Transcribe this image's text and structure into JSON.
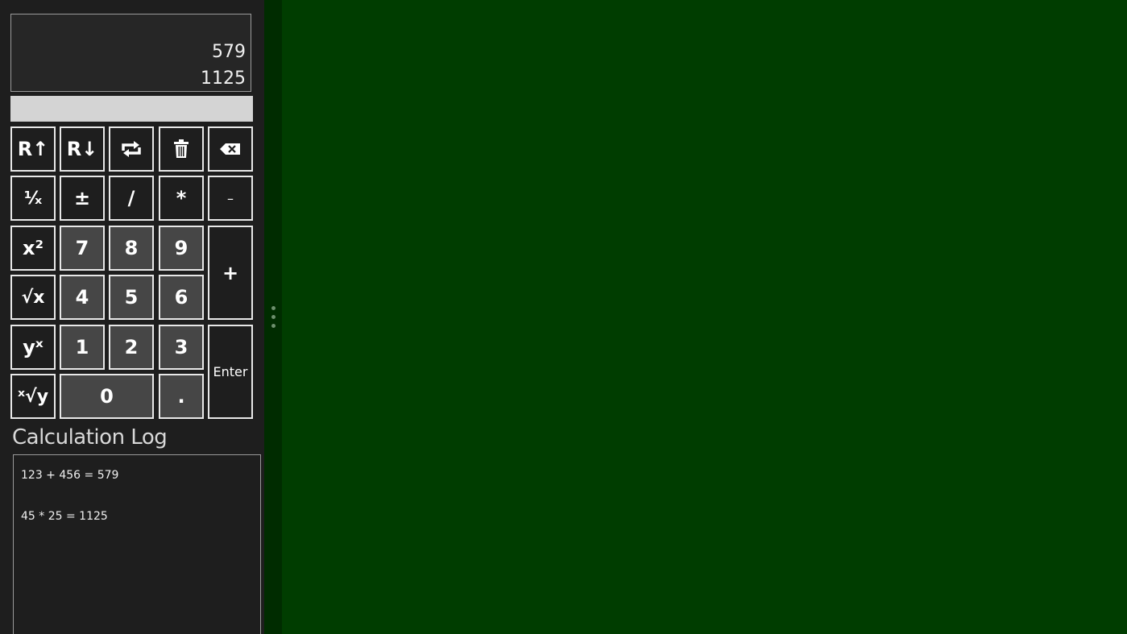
{
  "display": {
    "stack": [
      "579",
      "1125"
    ],
    "entry_value": ""
  },
  "keys": {
    "roll_up": "R↑",
    "roll_down": "R↓",
    "swap_icon": "swap-icon",
    "clear_icon": "trash-icon",
    "backspace_icon": "backspace-icon",
    "reciprocal": "¹⁄ₓ",
    "negate": "±",
    "divide": "/",
    "multiply": "*",
    "subtract": "–",
    "square": "x²",
    "sqrt": "√x",
    "power": "yˣ",
    "root": "ˣ√y",
    "add": "+",
    "enter": "Enter",
    "seven": "7",
    "eight": "8",
    "nine": "9",
    "four": "4",
    "five": "5",
    "six": "6",
    "one": "1",
    "two": "2",
    "three": "3",
    "zero": "0",
    "decimal": "."
  },
  "log": {
    "title": "Calculation Log",
    "entries": [
      "123 + 456 = 579",
      "45 * 25 = 1125"
    ]
  },
  "colors": {
    "background": "#003d00",
    "panel": "#1e1e1e",
    "digit_key": "#464646",
    "entry_field": "#d4d4d4"
  }
}
